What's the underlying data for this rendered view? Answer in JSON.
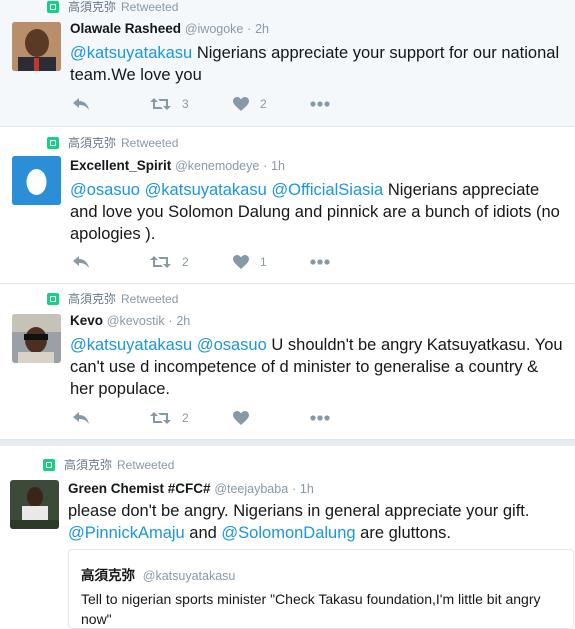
{
  "retweet_label": "Retweeted",
  "retweeter": "高須克弥",
  "tweets": [
    {
      "name": "Olawale Rasheed",
      "handle": "@iwogoke",
      "dot": "·",
      "time": "2h",
      "mentions": [
        "@katsuyatakasu"
      ],
      "text": "Nigerians appreciate your support for our national team.We love you",
      "retweets": "3",
      "likes": "2"
    },
    {
      "name": "Excellent_Spirit",
      "handle": "@kenemodeye",
      "dot": "·",
      "time": "1h",
      "mentions": [
        "@osasuo",
        "@katsuyatakasu",
        "@OfficialSiasia"
      ],
      "text": "Nigerians appreciate and love you Solomon Dalung and pinnick are a bunch of idiots (no apologies ).",
      "retweets": "2",
      "likes": "1"
    },
    {
      "name": "Kevo",
      "handle": "@kevostik",
      "dot": "·",
      "time": "2h",
      "mentions": [
        "@katsuyatakasu",
        "@osasuo"
      ],
      "text": "U shouldn't be angry Katsuyatkasu. You can't use d incompetence of d minister to generalise a country & her populace.",
      "retweets": "2",
      "likes": ""
    },
    {
      "name": "Green Chemist #CFC#",
      "handle": "@teejaybaba",
      "dot": "·",
      "time": "1h",
      "text_a": "please don't be angry. Nigerians in general appreciate your gift.",
      "mention_1": "@PinnickAmaju",
      "text_and": " and ",
      "mention_2": "@SolomonDalung",
      "text_b": " are gluttons."
    }
  ],
  "quote": {
    "name": "高須克弥",
    "handle": "@katsuyatakasu",
    "text": "Tell to nigerian sports minister \"Check Takasu foundation,I'm little bit angry now\""
  },
  "colors": {
    "accent": "#1b95e0",
    "retweet_green": "#19cf86",
    "muted": "#8899a6"
  }
}
